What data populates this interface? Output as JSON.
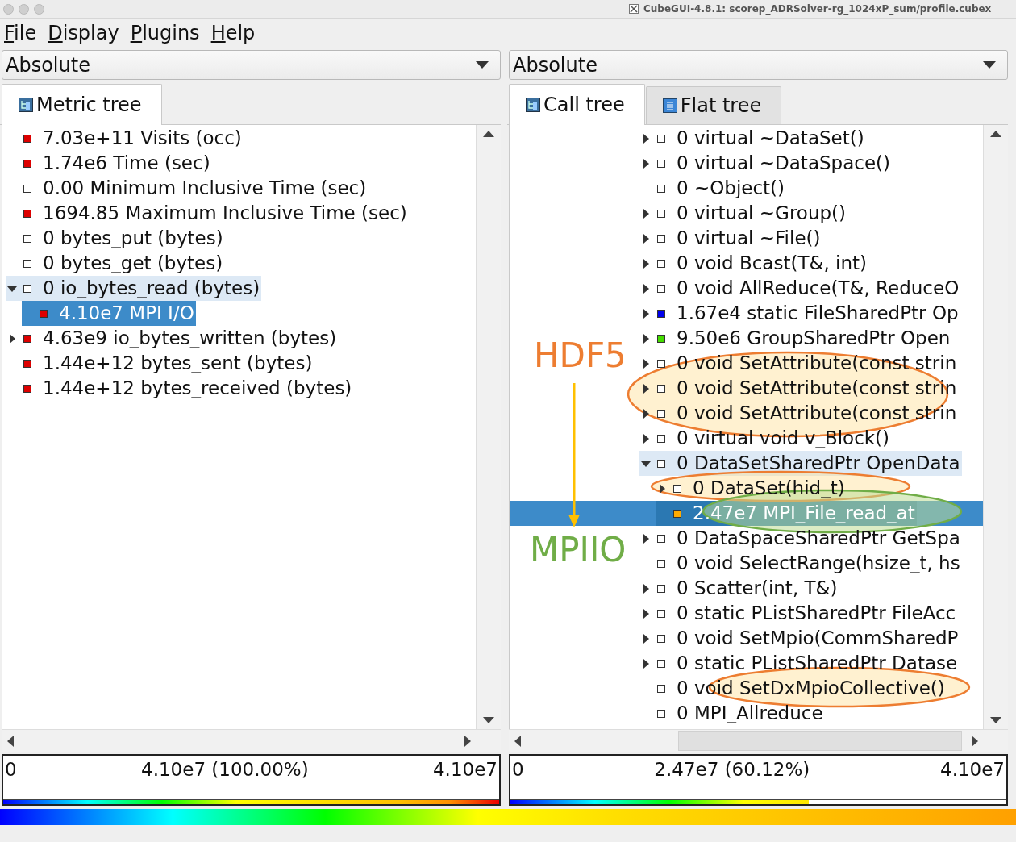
{
  "window": {
    "title": "CubeGUI-4.8.1: scorep_ADRSolver-rg_1024xP_sum/profile.cubex"
  },
  "menu": [
    "File",
    "Display",
    "Plugins",
    "Help"
  ],
  "panes": [
    {
      "mode": "Absolute",
      "tabs": [
        {
          "label": "Metric tree",
          "kind": "tree",
          "selected": true
        }
      ],
      "tree": [
        {
          "text": "7.03e+11 Visits (occ)",
          "color": "#dd0000",
          "expandable": false,
          "selected": false,
          "highlighted": false
        },
        {
          "text": "1.74e6 Time (sec)",
          "color": "#dd0000",
          "expandable": false,
          "selected": false,
          "highlighted": false
        },
        {
          "text": "0.00 Minimum Inclusive Time (sec)",
          "color": "#ffffff",
          "expandable": false,
          "selected": false,
          "highlighted": false
        },
        {
          "text": "1694.85 Maximum Inclusive Time (sec)",
          "color": "#dd0000",
          "expandable": false,
          "selected": false,
          "highlighted": false
        },
        {
          "text": "0 bytes_put (bytes)",
          "color": "#ffffff",
          "expandable": false,
          "selected": false,
          "highlighted": false
        },
        {
          "text": "0 bytes_get (bytes)",
          "color": "#ffffff",
          "expandable": false,
          "selected": false,
          "highlighted": false
        },
        {
          "text": "0 io_bytes_read (bytes)",
          "color": "#ffffff",
          "expandable": true,
          "expanded": true,
          "selected": false,
          "highlighted": true,
          "children": [
            {
              "text": "4.10e7 MPI I/O",
              "color": "#dd0000",
              "expandable": false,
              "selected": true,
              "highlighted": false
            }
          ]
        },
        {
          "text": "4.63e9 io_bytes_written (bytes)",
          "color": "#dd0000",
          "expandable": true,
          "expanded": false,
          "selected": false,
          "highlighted": false
        },
        {
          "text": "1.44e+12 bytes_sent (bytes)",
          "color": "#dd0000",
          "expandable": false,
          "selected": false,
          "highlighted": false
        },
        {
          "text": "1.44e+12 bytes_received (bytes)",
          "color": "#dd0000",
          "expandable": false,
          "selected": false,
          "highlighted": false
        }
      ],
      "value_bar": {
        "min": "0",
        "value": "4.10e7 (100.00%)",
        "max": "4.10e7",
        "level": 1.0
      }
    },
    {
      "mode": "Absolute",
      "tabs": [
        {
          "label": "Call tree",
          "kind": "tree",
          "selected": true
        },
        {
          "label": "Flat tree",
          "kind": "flat",
          "selected": false
        }
      ],
      "tree": [
        {
          "text": "0 virtual ~DataSet()",
          "color": "#ffffff",
          "expandable": true,
          "expanded": false,
          "selected": false,
          "highlighted": false
        },
        {
          "text": "0 virtual ~DataSpace()",
          "color": "#ffffff",
          "expandable": true,
          "expanded": false,
          "selected": false,
          "highlighted": false
        },
        {
          "text": "0 ~Object()",
          "color": "#ffffff",
          "expandable": false,
          "selected": false,
          "highlighted": false
        },
        {
          "text": "0 virtual ~Group()",
          "color": "#ffffff",
          "expandable": true,
          "expanded": false,
          "selected": false,
          "highlighted": false
        },
        {
          "text": "0 virtual ~File()",
          "color": "#ffffff",
          "expandable": true,
          "expanded": false,
          "selected": false,
          "highlighted": false
        },
        {
          "text": "0 void Bcast(T&, int)",
          "color": "#ffffff",
          "expandable": true,
          "expanded": false,
          "selected": false,
          "highlighted": false
        },
        {
          "text": "0 void AllReduce(T&, ReduceO",
          "color": "#ffffff",
          "expandable": true,
          "expanded": false,
          "selected": false,
          "highlighted": false
        },
        {
          "text": "1.67e4 static FileSharedPtr Op",
          "color": "#0000ee",
          "expandable": true,
          "expanded": false,
          "selected": false,
          "highlighted": false
        },
        {
          "text": "9.50e6 GroupSharedPtr Open",
          "color": "#44dd00",
          "expandable": true,
          "expanded": false,
          "selected": false,
          "highlighted": false
        },
        {
          "text": "0 void SetAttribute(const strin",
          "color": "#ffffff",
          "expandable": true,
          "expanded": false,
          "selected": false,
          "highlighted": false
        },
        {
          "text": "0 void SetAttribute(const strin",
          "color": "#ffffff",
          "expandable": true,
          "expanded": false,
          "selected": false,
          "highlighted": false
        },
        {
          "text": "0 void SetAttribute(const strin",
          "color": "#ffffff",
          "expandable": true,
          "expanded": false,
          "selected": false,
          "highlighted": false
        },
        {
          "text": "0 virtual void v_Block()",
          "color": "#ffffff",
          "expandable": true,
          "expanded": false,
          "selected": false,
          "highlighted": false
        },
        {
          "text": "0 DataSetSharedPtr OpenData",
          "color": "#ffffff",
          "expandable": true,
          "expanded": true,
          "selected": false,
          "highlighted": true,
          "children": [
            {
              "text": "0 DataSet(hid_t)",
              "color": "#ffffff",
              "expandable": true,
              "expanded": false,
              "selected": false,
              "highlighted": false
            },
            {
              "text": "2.47e7 MPI_File_read_at",
              "color": "#ffaa00",
              "expandable": false,
              "selected": true,
              "highlighted": false
            }
          ]
        },
        {
          "text": "0 DataSpaceSharedPtr GetSpa",
          "color": "#ffffff",
          "expandable": true,
          "expanded": false,
          "selected": false,
          "highlighted": false
        },
        {
          "text": "0 void SelectRange(hsize_t, hs",
          "color": "#ffffff",
          "expandable": false,
          "selected": false,
          "highlighted": false
        },
        {
          "text": "0 Scatter(int, T&)",
          "color": "#ffffff",
          "expandable": true,
          "expanded": false,
          "selected": false,
          "highlighted": false
        },
        {
          "text": "0 static PListSharedPtr FileAcc",
          "color": "#ffffff",
          "expandable": true,
          "expanded": false,
          "selected": false,
          "highlighted": false
        },
        {
          "text": "0 void SetMpio(CommSharedP",
          "color": "#ffffff",
          "expandable": true,
          "expanded": false,
          "selected": false,
          "highlighted": false
        },
        {
          "text": "0 static PListSharedPtr Datase",
          "color": "#ffffff",
          "expandable": true,
          "expanded": false,
          "selected": false,
          "highlighted": false
        },
        {
          "text": "0 void SetDxMpioCollective()",
          "color": "#ffffff",
          "expandable": false,
          "selected": false,
          "highlighted": false
        },
        {
          "text": "0 MPI_Allreduce",
          "color": "#ffffff",
          "expandable": false,
          "selected": false,
          "highlighted": false
        }
      ],
      "value_bar": {
        "min": "0",
        "value": "2.47e7 (60.12%)",
        "max": "4.10e7",
        "level": 0.6012
      }
    }
  ],
  "annotations": {
    "labels": [
      {
        "text": "HDF5",
        "color": "#ed7d31"
      },
      {
        "text": "MPIIO",
        "color": "#70ad47"
      }
    ],
    "ellipses": [
      {
        "color": "#ed7d31"
      },
      {
        "color": "#ed7d31"
      },
      {
        "color": "#70ad47"
      },
      {
        "color": "#ed7d31"
      }
    ],
    "arrow": {
      "color": "#ffc000"
    }
  }
}
